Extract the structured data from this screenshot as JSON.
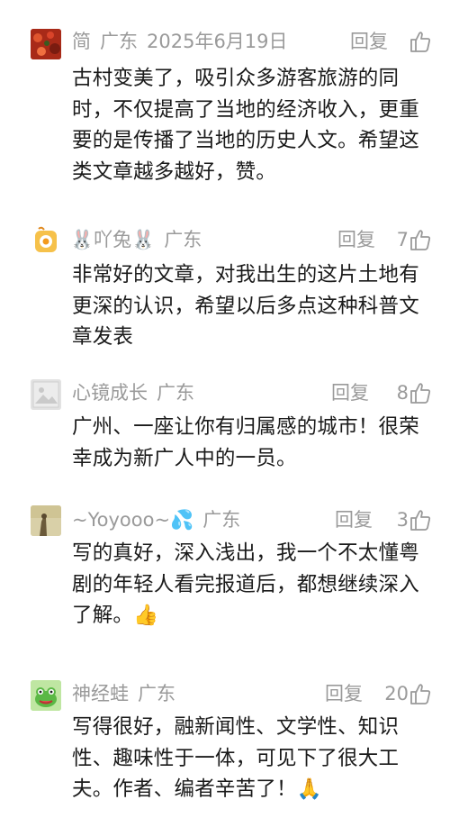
{
  "comments": [
    {
      "name": "简",
      "location": "广东",
      "date": "2025年6月19日",
      "reply_label": "回复",
      "likes": "",
      "text": "古村变美了，吸引众多游客旅游的同时，不仅提高了当地的经济收入，更重要的是传播了当地的历史人文。希望这类文章越多越好，赞。"
    },
    {
      "name": "🐰吖兔🐰",
      "location": "广东",
      "date": "",
      "reply_label": "回复",
      "likes": "7",
      "text": "非常好的文章，对我出生的这片土地有更深的认识，希望以后多点这种科普文章发表"
    },
    {
      "name": "心镜成长",
      "location": "广东",
      "date": "",
      "reply_label": "回复",
      "likes": "8",
      "text": "广州、一座让你有归属感的城市！很荣幸成为新广人中的一员。"
    },
    {
      "name": "~Yoyooo~💦",
      "location": "广东",
      "date": "",
      "reply_label": "回复",
      "likes": "3",
      "text": "写的真好，深入浅出，我一个不太懂粤剧的年轻人看完报道后，都想继续深入了解。👍"
    },
    {
      "name": "神经蛙",
      "location": "广东",
      "date": "",
      "reply_label": "回复",
      "likes": "20",
      "text": "写得很好，融新闻性、文学性、知识性、趣味性于一体，可见下了很大工夫。作者、编者辛苦了！🙏"
    }
  ],
  "icons": {
    "like": "thumbs-up-icon"
  }
}
